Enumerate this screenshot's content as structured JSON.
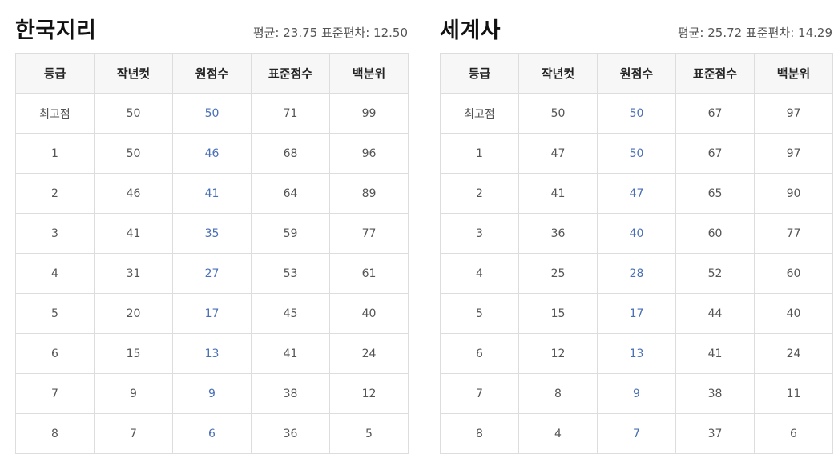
{
  "tables": [
    {
      "title": "한국지리",
      "mean_label": "평균:",
      "mean": "23.75",
      "sd_label": "표준편차:",
      "sd": "12.50",
      "headers": [
        "등급",
        "작년컷",
        "원점수",
        "표준점수",
        "백분위"
      ],
      "rows": [
        [
          "최고점",
          "50",
          "50",
          "71",
          "99"
        ],
        [
          "1",
          "50",
          "46",
          "68",
          "96"
        ],
        [
          "2",
          "46",
          "41",
          "64",
          "89"
        ],
        [
          "3",
          "41",
          "35",
          "59",
          "77"
        ],
        [
          "4",
          "31",
          "27",
          "53",
          "61"
        ],
        [
          "5",
          "20",
          "17",
          "45",
          "40"
        ],
        [
          "6",
          "15",
          "13",
          "41",
          "24"
        ],
        [
          "7",
          "9",
          "9",
          "38",
          "12"
        ],
        [
          "8",
          "7",
          "6",
          "36",
          "5"
        ]
      ]
    },
    {
      "title": "세계사",
      "mean_label": "평균:",
      "mean": "25.72",
      "sd_label": "표준편차:",
      "sd": "14.29",
      "headers": [
        "등급",
        "작년컷",
        "원점수",
        "표준점수",
        "백분위"
      ],
      "rows": [
        [
          "최고점",
          "50",
          "50",
          "67",
          "97"
        ],
        [
          "1",
          "47",
          "50",
          "67",
          "97"
        ],
        [
          "2",
          "41",
          "47",
          "65",
          "90"
        ],
        [
          "3",
          "36",
          "40",
          "60",
          "77"
        ],
        [
          "4",
          "25",
          "28",
          "52",
          "60"
        ],
        [
          "5",
          "15",
          "17",
          "44",
          "40"
        ],
        [
          "6",
          "12",
          "13",
          "41",
          "24"
        ],
        [
          "7",
          "8",
          "9",
          "38",
          "11"
        ],
        [
          "8",
          "4",
          "7",
          "37",
          "6"
        ]
      ]
    }
  ],
  "colors": {
    "raw_score": "#4a6fb5",
    "header_bg": "#f7f7f7",
    "border": "#dddddd",
    "top_rule": "#333333"
  }
}
